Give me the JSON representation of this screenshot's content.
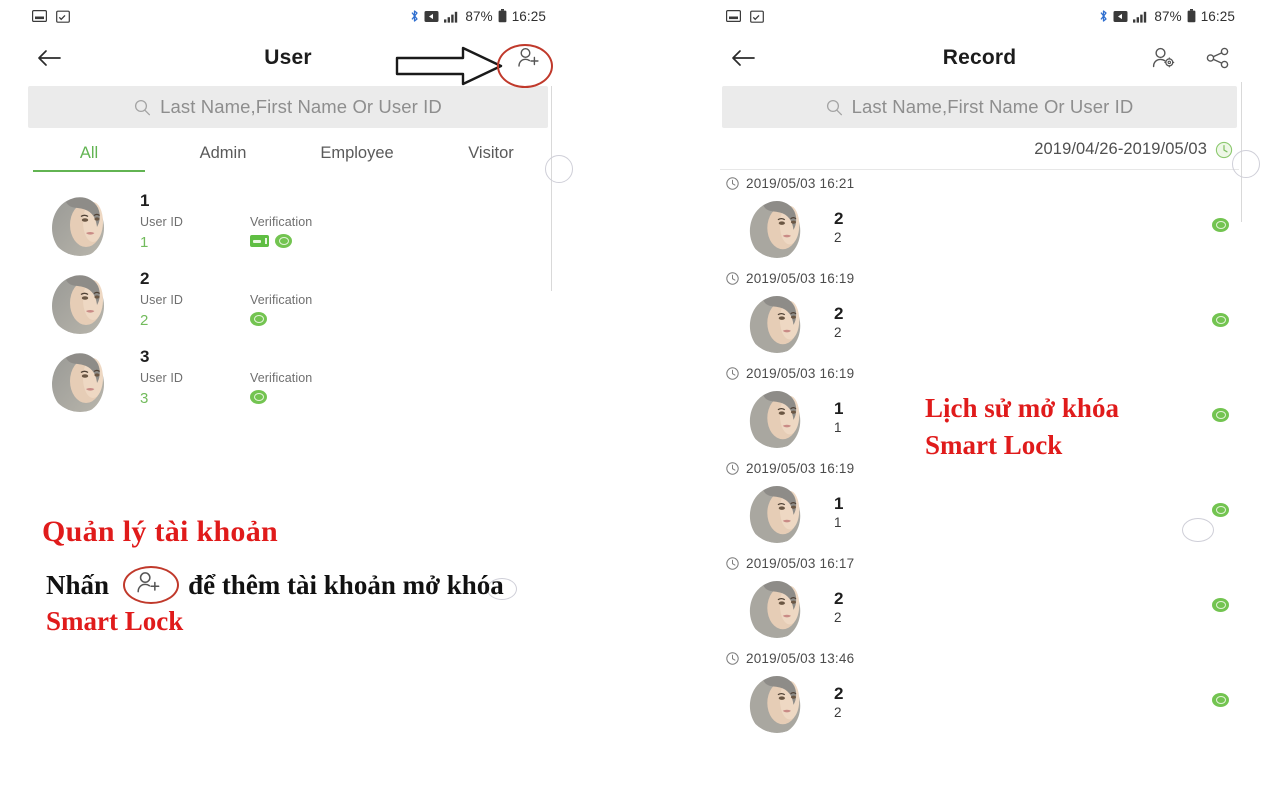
{
  "statusbar": {
    "left_icons": [
      "image-icon",
      "calendar-icon"
    ],
    "right_icons": [
      "bluetooth-icon",
      "vibrate-icon",
      "signal-icon",
      "battery-icon"
    ],
    "battery_percent": "87%",
    "time": "16:25"
  },
  "colors": {
    "accent_green": "#62b452",
    "value_green": "#72bb5c",
    "annotation_red": "#e01b1b",
    "search_bg": "#ebebeb",
    "title_black": "#1c1c1c"
  },
  "left_panel": {
    "appbar": {
      "back_icon": "back-arrow-icon",
      "title": "User",
      "action_icon": "add-user-icon"
    },
    "search": {
      "icon": "search-icon",
      "placeholder": "Last Name,First Name Or User ID",
      "value": ""
    },
    "tabs": [
      {
        "label": "All",
        "active": true
      },
      {
        "label": "Admin",
        "active": false
      },
      {
        "label": "Employee",
        "active": false
      },
      {
        "label": "Visitor",
        "active": false
      }
    ],
    "column_labels": {
      "user_id": "User ID",
      "verification": "Verification"
    },
    "users": [
      {
        "name": "1",
        "user_id": "1",
        "badges": [
          "card-badge",
          "face-badge"
        ]
      },
      {
        "name": "2",
        "user_id": "2",
        "badges": [
          "face-badge"
        ]
      },
      {
        "name": "3",
        "user_id": "3",
        "badges": [
          "face-badge"
        ]
      }
    ]
  },
  "right_panel": {
    "appbar": {
      "back_icon": "back-arrow-icon",
      "title": "Record",
      "action_icons": [
        "user-settings-icon",
        "share-icon"
      ]
    },
    "search": {
      "icon": "search-icon",
      "placeholder": "Last Name,First Name Or User ID",
      "value": ""
    },
    "date_range": {
      "text": "2019/04/26-2019/05/03",
      "icon": "clock-icon"
    },
    "records": [
      {
        "time": "2019/05/03 16:21",
        "name": "2",
        "user_id": "2",
        "status": "face-badge"
      },
      {
        "time": "2019/05/03 16:19",
        "name": "2",
        "user_id": "2",
        "status": "face-badge"
      },
      {
        "time": "2019/05/03 16:19",
        "name": "1",
        "user_id": "1",
        "status": "face-badge"
      },
      {
        "time": "2019/05/03 16:19",
        "name": "1",
        "user_id": "1",
        "status": "face-badge"
      },
      {
        "time": "2019/05/03 16:17",
        "name": "2",
        "user_id": "2",
        "status": "face-badge"
      },
      {
        "time": "2019/05/03 13:46",
        "name": "2",
        "user_id": "2",
        "status": "face-badge"
      }
    ]
  },
  "annotations": {
    "left_title": "Quản lý tài khoản",
    "left_body_pre": "Nhấn",
    "left_body_mid": "để thêm tài khoản mở khóa",
    "left_body_highlight": "Smart Lock",
    "right_title": "Lịch sử mở khóa Smart Lock",
    "arrow": "right-arrow-annotation"
  }
}
